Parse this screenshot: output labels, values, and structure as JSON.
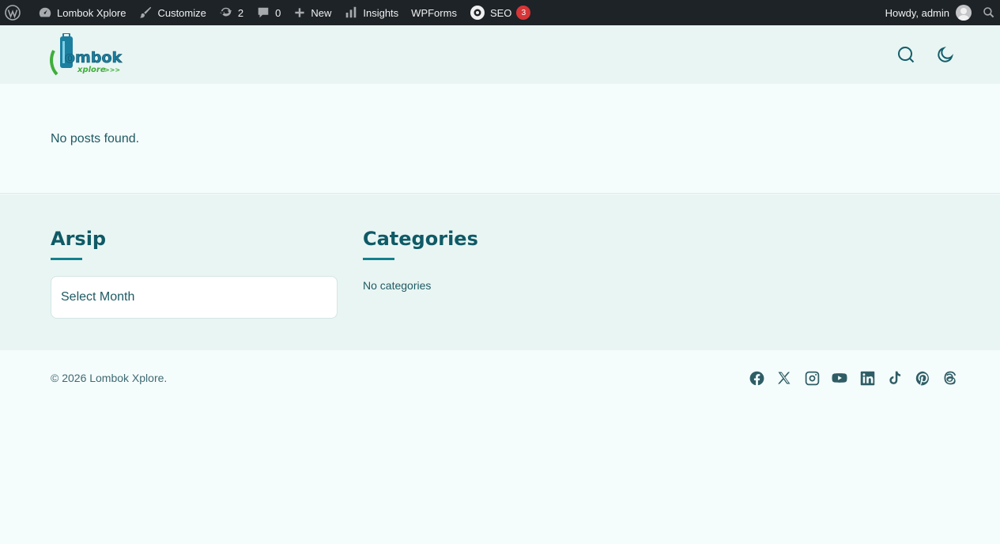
{
  "adminbar": {
    "site_name": "Lombok Xplore",
    "customize": "Customize",
    "updates_count": "2",
    "comments_count": "0",
    "new_label": "New",
    "insights": "Insights",
    "wpforms": "WPForms",
    "seo": "SEO",
    "seo_badge": "3",
    "howdy": "Howdy, admin"
  },
  "header": {
    "logo_text": "Lombok",
    "logo_sub": "Xplore"
  },
  "main": {
    "message": "No posts found."
  },
  "widgets": {
    "archive_title": "Arsip",
    "archive_select": "Select Month",
    "categories_title": "Categories",
    "categories_empty": "No categories"
  },
  "footer": {
    "copyright": "© 2026 Lombok Xplore."
  },
  "colors": {
    "accent": "#135e6b",
    "adminbar": "#1d2327",
    "badge": "#d63638"
  }
}
